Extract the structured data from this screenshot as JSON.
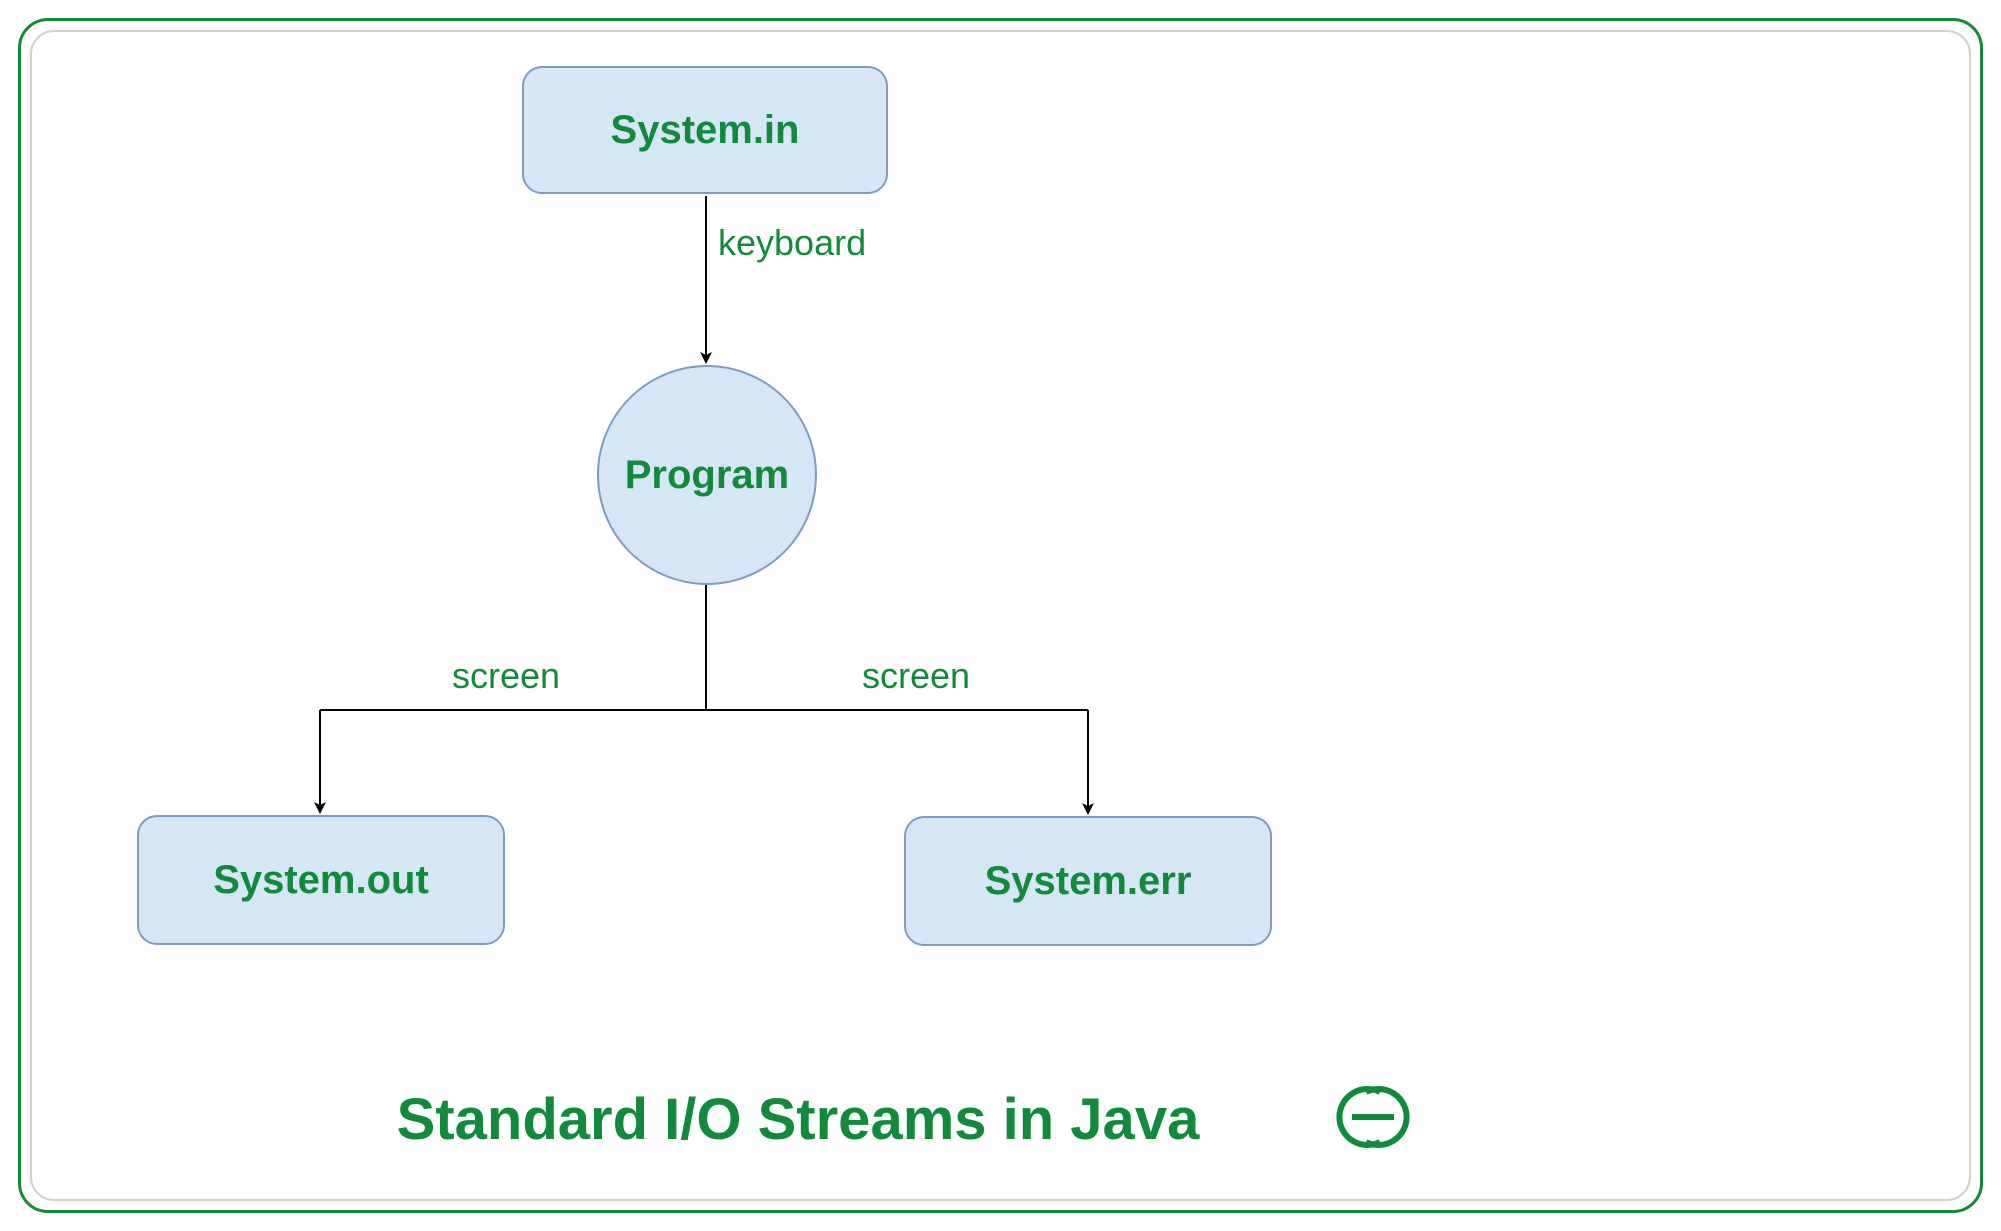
{
  "diagram": {
    "title": "Standard I/O Streams in Java",
    "nodes": {
      "system_in": {
        "label": "System.in"
      },
      "program": {
        "label": "Program"
      },
      "system_out": {
        "label": "System.out"
      },
      "system_err": {
        "label": "System.err"
      }
    },
    "edges": {
      "in_to_program": {
        "label": "keyboard"
      },
      "program_to_out": {
        "label": "screen"
      },
      "program_to_err": {
        "label": "screen"
      }
    },
    "logo": "GG"
  }
}
